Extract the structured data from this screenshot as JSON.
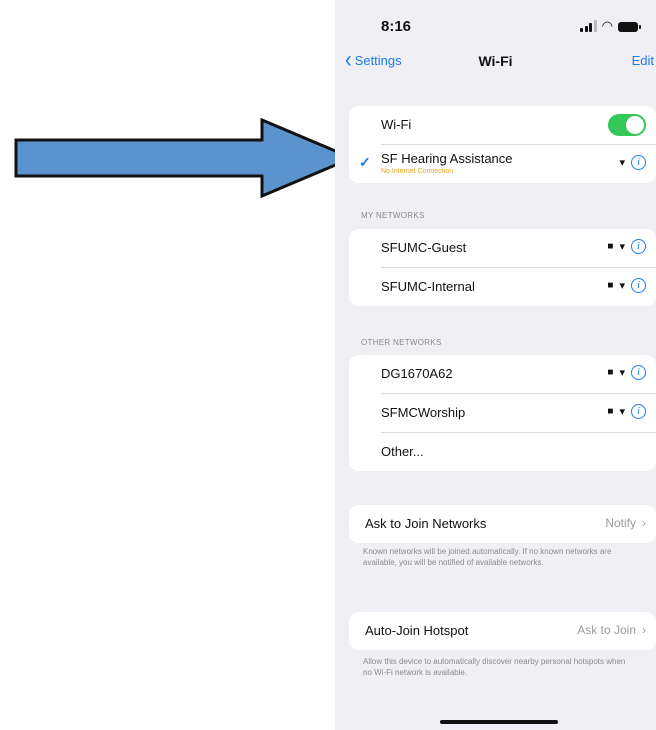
{
  "status_bar": {
    "time": "8:16"
  },
  "nav": {
    "back_label": "Settings",
    "title": "Wi-Fi",
    "edit_label": "Edit"
  },
  "wifi": {
    "label": "Wi-Fi",
    "enabled": true,
    "connected": {
      "name": "SF Hearing Assistance",
      "status": "No Internet Connection"
    }
  },
  "my_networks": {
    "header": "MY NETWORKS",
    "items": [
      {
        "name": "SFUMC-Guest"
      },
      {
        "name": "SFUMC-Internal"
      }
    ]
  },
  "other_networks": {
    "header": "OTHER NETWORKS",
    "items": [
      {
        "name": "DG1670A62"
      },
      {
        "name": "SFMCWorship"
      }
    ],
    "other_label": "Other..."
  },
  "ask_to_join": {
    "label": "Ask to Join Networks",
    "value": "Notify",
    "description": "Known networks will be joined automatically. If no known networks are available, you will be notified of available networks."
  },
  "auto_join": {
    "label": "Auto-Join Hotspot",
    "value": "Ask to Join",
    "description": "Allow this device to automatically discover nearby personal hotspots when no Wi-Fi network is available."
  },
  "colors": {
    "accent": "#1a7cf4",
    "toggle_on": "#34c759",
    "warning": "#f0a11c",
    "arrow_fill": "#5b93cf"
  }
}
